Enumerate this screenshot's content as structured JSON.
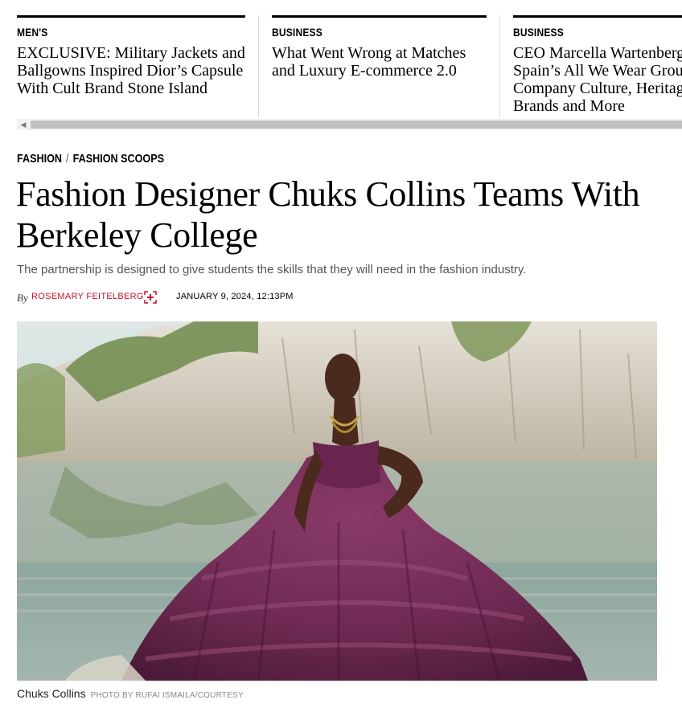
{
  "carousel": {
    "cards": [
      {
        "category": "MEN'S",
        "headline_lines": [
          "EXCLUSIVE: Military Jackets and",
          "Ballgowns Inspired Dior’s Capsule",
          "With Cult Brand Stone Island"
        ]
      },
      {
        "category": "BUSINESS",
        "headline_lines": [
          "What Went Wrong at Matches",
          "and Luxury E-commerce 2.0"
        ]
      },
      {
        "category": "BUSINESS",
        "headline_lines": [
          "CEO Marcella Wartenbergh",
          "Spain’s All We Wear Group",
          "Company Culture, Heritage",
          "Brands and More"
        ]
      }
    ],
    "scroll_left_glyph": "◀"
  },
  "article": {
    "breadcrumb": [
      "FASHION",
      "FASHION SCOOPS"
    ],
    "breadcrumb_separator": "/",
    "title_lines": [
      "Fashion Designer Chuks Collins Teams With",
      "Berkeley College"
    ],
    "dek": "The partnership is designed to give students the skills that they will need in the fashion industry.",
    "byline_prefix": "By",
    "author": "ROSEMARY FEITELBERG",
    "author_icon": "follow-plus-icon",
    "date": "JANUARY 9, 2024, 12:13PM",
    "image_caption": "Chuks Collins",
    "image_credit": "PHOTO BY RUFAI ISMAILA/COURTESY"
  },
  "colors": {
    "accent_red": "#c8102e",
    "dress_purple": "#6e2a52"
  }
}
